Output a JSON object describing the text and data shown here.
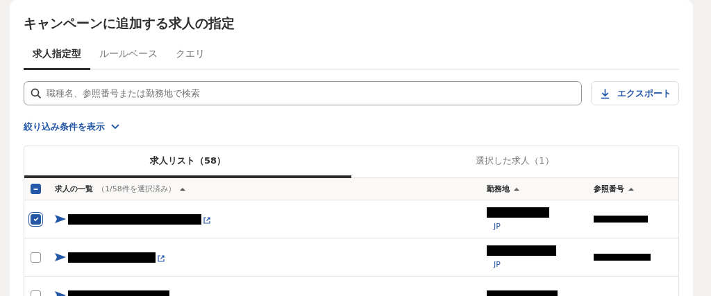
{
  "title": "キャンペーンに追加する求人の指定",
  "tabs": [
    {
      "label": "求人指定型",
      "selected": true
    },
    {
      "label": "ルールベース",
      "selected": false
    },
    {
      "label": "クエリ",
      "selected": false
    }
  ],
  "search": {
    "placeholder": "職種名、参照番号または勤務地で検索"
  },
  "export_button": "エクスポート",
  "filter_toggle": {
    "label": "絞り込み条件を表示",
    "expanded": false
  },
  "list_tabs": [
    {
      "label": "求人リスト（58）",
      "selected": true
    },
    {
      "label": "選択した求人（1）",
      "selected": false
    }
  ],
  "table": {
    "select_all": {
      "indeterminate": true
    },
    "columns": [
      {
        "label": "求人の一覧",
        "note": "（1/58件を選択済み）"
      },
      {
        "label": "勤務地"
      },
      {
        "label": "参照番号"
      }
    ],
    "rows": [
      {
        "checked": true,
        "country": "JP",
        "external_link": true
      },
      {
        "checked": false,
        "country": "JP",
        "external_link": true
      },
      {
        "checked": false
      }
    ]
  }
}
